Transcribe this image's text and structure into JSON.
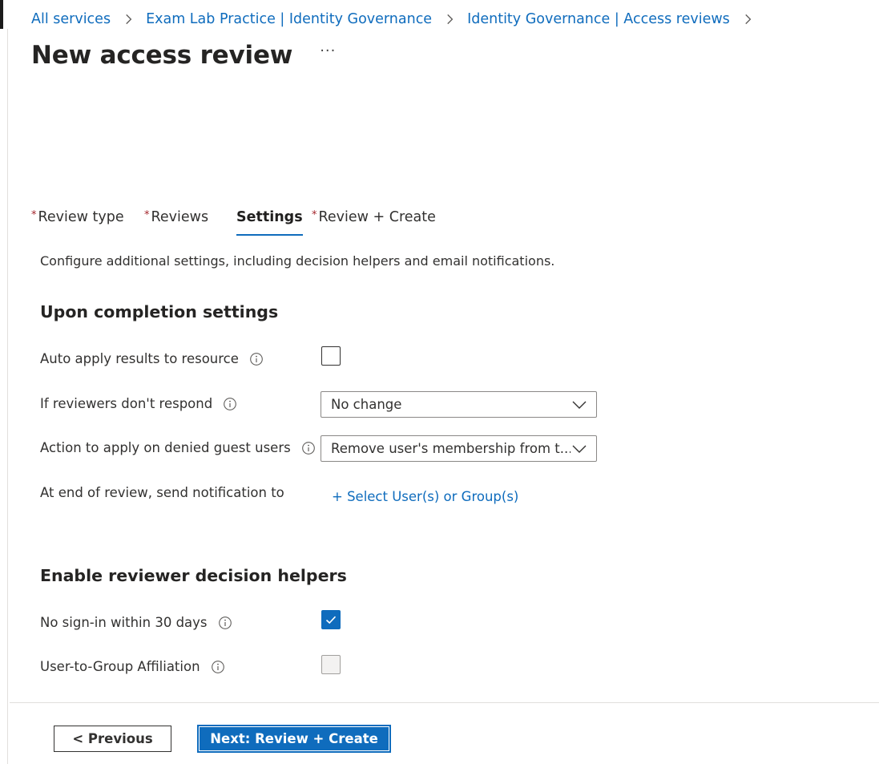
{
  "breadcrumb": {
    "items": [
      "All services",
      "Exam Lab Practice | Identity Governance",
      "Identity Governance | Access reviews"
    ]
  },
  "page": {
    "title": "New access review",
    "more_label": "···"
  },
  "tabs": [
    {
      "label": "Review type",
      "required": true,
      "active": false
    },
    {
      "label": "Reviews",
      "required": true,
      "active": false
    },
    {
      "label": "Settings",
      "required": false,
      "active": true
    },
    {
      "label": "Review + Create",
      "required": true,
      "active": false
    }
  ],
  "required_marker": "*",
  "description": "Configure additional settings, including decision helpers and email notifications.",
  "completion": {
    "heading": "Upon completion settings",
    "auto_apply": {
      "label": "Auto apply results to resource",
      "checked": false
    },
    "no_response": {
      "label": "If reviewers don't respond",
      "value": "No change"
    },
    "denied_guests": {
      "label": "Action to apply on denied guest users",
      "value": "Remove user's membership from t..."
    },
    "notify": {
      "label": "At end of review, send notification to",
      "link": "+ Select User(s) or Group(s)"
    }
  },
  "helpers": {
    "heading": "Enable reviewer decision helpers",
    "no_signin": {
      "label": "No sign-in within 30 days",
      "checked": true
    },
    "affiliation": {
      "label": "User-to-Group Affiliation",
      "checked": false,
      "disabled": true
    }
  },
  "footer": {
    "previous_label": "< Previous",
    "next_label": "Next: Review + Create"
  },
  "colors": {
    "accent": "#0f6cbd",
    "required": "#a4262c"
  }
}
